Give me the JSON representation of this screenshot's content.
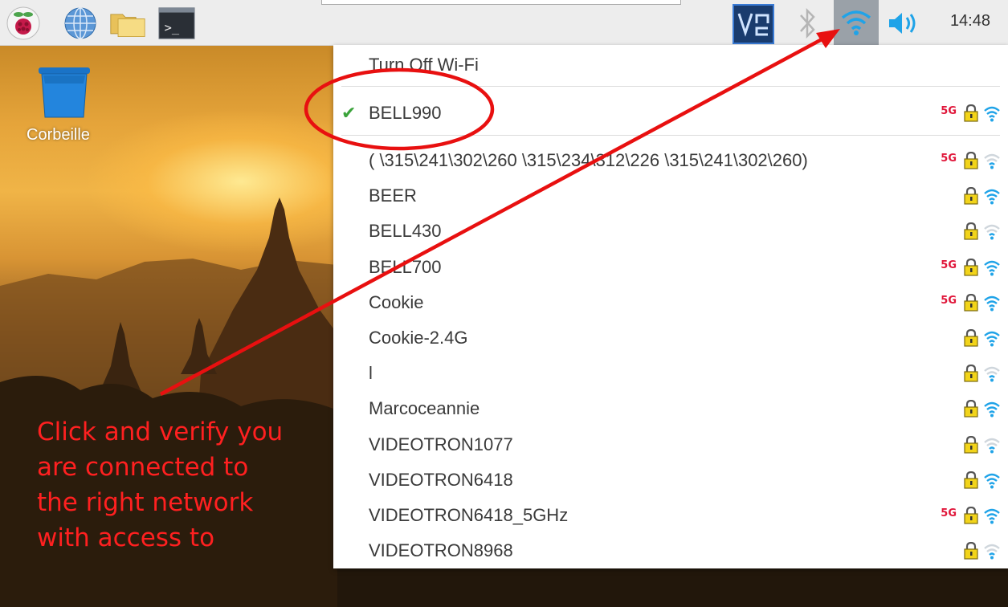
{
  "taskbar": {
    "icons": [
      "raspberry-menu-icon",
      "web-browser-icon",
      "file-manager-icon",
      "terminal-icon",
      "vnc-icon",
      "bluetooth-icon",
      "wifi-icon",
      "volume-icon"
    ],
    "terminal_glyph": ">_",
    "clock": "14:48"
  },
  "desktop": {
    "trash_label": "Corbeille"
  },
  "wifi_menu": {
    "toggle_label": "Turn Off Wi-Fi",
    "connected": {
      "ssid": "BELL990",
      "band": "5G",
      "secured": true,
      "signal": "strong"
    },
    "networks": [
      {
        "ssid": "( \\315\\241\\302\\260 \\315\\234\\312\\226 \\315\\241\\302\\260)",
        "band": "5G",
        "secured": true,
        "signal": "weak"
      },
      {
        "ssid": "BEER",
        "band": "",
        "secured": true,
        "signal": "strong"
      },
      {
        "ssid": "BELL430",
        "band": "",
        "secured": true,
        "signal": "weak"
      },
      {
        "ssid": "BELL700",
        "band": "5G",
        "secured": true,
        "signal": "strong"
      },
      {
        "ssid": "Cookie",
        "band": "5G",
        "secured": true,
        "signal": "strong"
      },
      {
        "ssid": "Cookie-2.4G",
        "band": "",
        "secured": true,
        "signal": "strong"
      },
      {
        "ssid": "l",
        "band": "",
        "secured": true,
        "signal": "weak"
      },
      {
        "ssid": "Marcoceannie",
        "band": "",
        "secured": true,
        "signal": "strong"
      },
      {
        "ssid": "VIDEOTRON1077",
        "band": "",
        "secured": true,
        "signal": "weak"
      },
      {
        "ssid": "VIDEOTRON6418",
        "band": "",
        "secured": true,
        "signal": "strong"
      },
      {
        "ssid": "VIDEOTRON6418_5GHz",
        "band": "5G",
        "secured": true,
        "signal": "strong"
      },
      {
        "ssid": "VIDEOTRON8968",
        "band": "",
        "secured": true,
        "signal": "weak"
      }
    ]
  },
  "annotation": {
    "lines": [
      "Click and verify you",
      "are connected to",
      "the right network",
      "with access to"
    ],
    "color": "#ff2020"
  },
  "colors": {
    "wifi_blue": "#1fa3e8",
    "band_red": "#e0163a",
    "check_green": "#3aa33a",
    "lock_yellow": "#f2d41a"
  }
}
